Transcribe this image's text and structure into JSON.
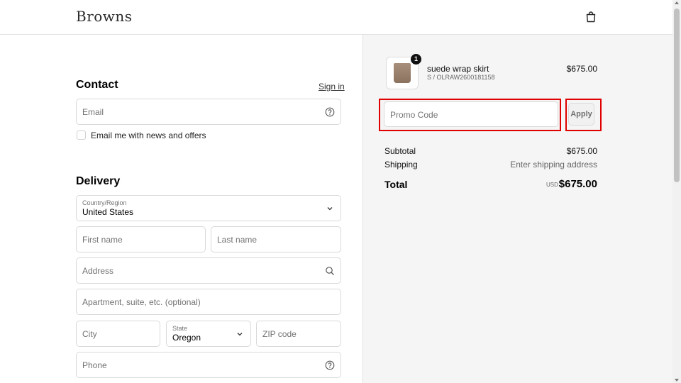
{
  "header": {
    "logo": "Browns"
  },
  "contact": {
    "title": "Contact",
    "sign_in": "Sign in",
    "email_placeholder": "Email",
    "newsletter_label": "Email me with news and offers"
  },
  "delivery": {
    "title": "Delivery",
    "country_label": "Country/Region",
    "country_value": "United States",
    "first_name_placeholder": "First name",
    "last_name_placeholder": "Last name",
    "address_placeholder": "Address",
    "apartment_placeholder": "Apartment, suite, etc. (optional)",
    "city_placeholder": "City",
    "state_label": "State",
    "state_value": "Oregon",
    "zip_placeholder": "ZIP code",
    "phone_placeholder": "Phone"
  },
  "order": {
    "item": {
      "quantity": "1",
      "name": "suede wrap skirt",
      "variant": "S / OLRAW2600181158",
      "price": "$675.00"
    },
    "promo_placeholder": "Promo Code",
    "apply_label": "Apply",
    "subtotal_label": "Subtotal",
    "subtotal_value": "$675.00",
    "shipping_label": "Shipping",
    "shipping_value": "Enter shipping address",
    "total_label": "Total",
    "currency": "USD",
    "total_value": "$675.00"
  },
  "colors": {
    "highlight": "#e10000",
    "summary_bg": "#f5f5f5"
  }
}
